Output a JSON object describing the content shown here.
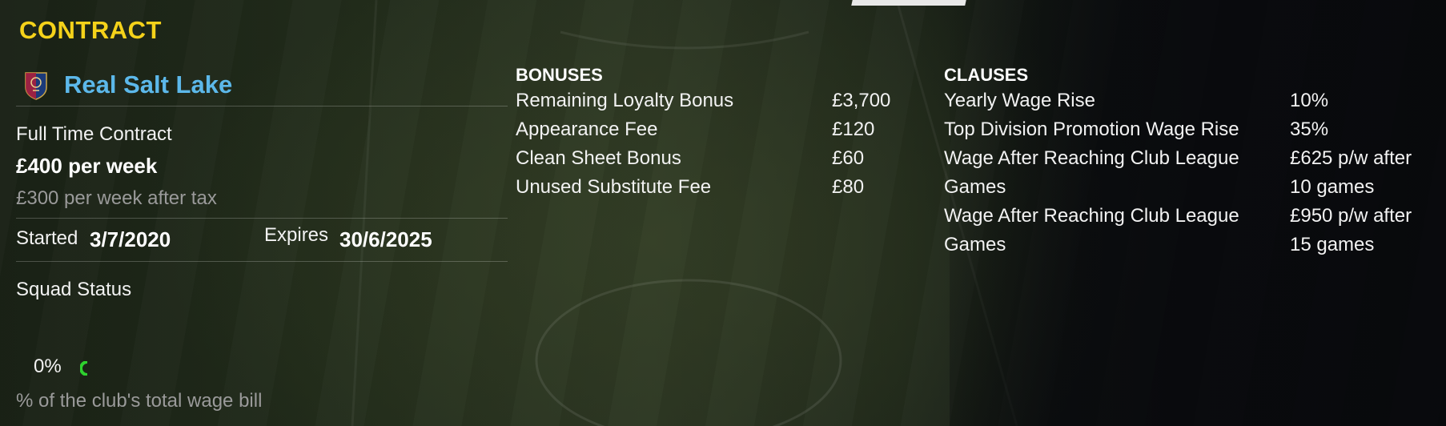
{
  "section_title": "CONTRACT",
  "club": {
    "name": "Real Salt Lake",
    "crest_icon": "club-crest-icon"
  },
  "contract": {
    "type": "Full Time Contract",
    "wage": "£400 per week",
    "after_tax": "£300 per week after tax",
    "started_label": "Started",
    "started_value": "3/7/2020",
    "expires_label": "Expires",
    "expires_value": "30/6/2025"
  },
  "squad_status_label": "Squad Status",
  "wage_bill": {
    "percent": "0%",
    "caption": "% of the club's total wage bill",
    "ring_color": "#2ed12e"
  },
  "bonuses": {
    "heading": "BONUSES",
    "rows": [
      {
        "label": "Remaining Loyalty Bonus",
        "value": "£3,700"
      },
      {
        "label": "Appearance Fee",
        "value": "£120"
      },
      {
        "label": "Clean Sheet Bonus",
        "value": "£60"
      },
      {
        "label": "Unused Substitute Fee",
        "value": "£80"
      }
    ]
  },
  "clauses": {
    "heading": "CLAUSES",
    "rows": [
      {
        "label": "Yearly Wage Rise",
        "value": "10%"
      },
      {
        "label": "Top Division Promotion Wage Rise",
        "value": "35%"
      },
      {
        "label": "Wage After Reaching Club League",
        "value": "£625 p/w after"
      },
      {
        "label": "Games",
        "value": "10 games"
      },
      {
        "label": "Wage After Reaching Club League",
        "value": "£950 p/w after"
      },
      {
        "label": "Games",
        "value": "15 games"
      }
    ]
  },
  "colors": {
    "title": "#f5d21a",
    "club_name": "#5cb8ea",
    "muted_text": "#9a9a9a"
  }
}
